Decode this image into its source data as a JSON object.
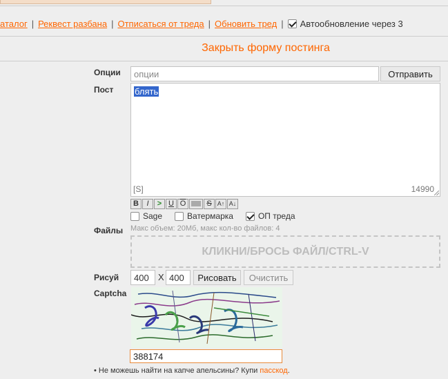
{
  "thread_links": {
    "catalog": "аталог",
    "request_ban": "Реквест разбана",
    "unsubscribe": "Отписаться от треда",
    "refresh": "Обновить тред",
    "auto_refresh_label": "Автообновление через 3",
    "auto_refresh_checked": true
  },
  "form": {
    "close_label": "Закрыть форму постинга",
    "options_label": "Опции",
    "options_placeholder": "опции",
    "submit_label": "Отправить",
    "post_label": "Пост",
    "post_text": "блять",
    "sage_tag": "[S]",
    "char_counter": "14990",
    "format_buttons": [
      "B",
      "I",
      ">",
      "U",
      "O",
      "",
      "S",
      "A↑",
      "A↓"
    ],
    "checkboxes": [
      {
        "label": "Sage",
        "checked": false
      },
      {
        "label": "Ватермарка",
        "checked": false
      },
      {
        "label": "ОП треда",
        "checked": true
      }
    ],
    "files_label": "Файлы",
    "files_hint": "Макс объем: 20Мб, макс кол-во файлов: 4",
    "dropzone_label": "КЛИКНИ/БРОСЬ ФАЙЛ/CTRL-V",
    "draw_label": "Рисуй",
    "draw_width": "400",
    "draw_x": "X",
    "draw_height": "400",
    "draw_button": "Рисовать",
    "clear_button": "Очистить",
    "captcha_label": "Captcha",
    "captcha_value": "388174",
    "passcode_text": "• Не можешь найти на капче апельсины? Купи",
    "passcode_link": "пасскод",
    "passcode_end": "."
  },
  "colors": {
    "accent": "#ff6600",
    "background": "#eeeeee",
    "captcha_bg": "#eaf5ea"
  }
}
